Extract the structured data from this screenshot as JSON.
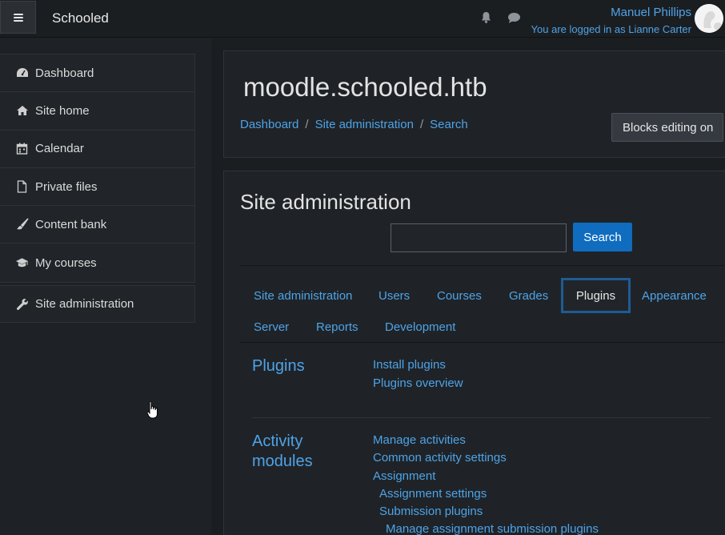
{
  "navbar": {
    "brand": "Schooled",
    "user_name": "Manuel Phillips",
    "logged_in_text": "You are logged in as Lianne Carter"
  },
  "sidebar": {
    "items": [
      {
        "label": "Dashboard",
        "icon": "dashboard-icon"
      },
      {
        "label": "Site home",
        "icon": "home-icon"
      },
      {
        "label": "Calendar",
        "icon": "calendar-icon"
      },
      {
        "label": "Private files",
        "icon": "file-icon"
      },
      {
        "label": "Content bank",
        "icon": "brush-icon"
      },
      {
        "label": "My courses",
        "icon": "graduation-cap-icon"
      }
    ],
    "admin_item": {
      "label": "Site administration",
      "icon": "wrench-icon"
    }
  },
  "header": {
    "title": "moodle.schooled.htb",
    "breadcrumb": [
      "Dashboard",
      "Site administration",
      "Search"
    ],
    "blocks_editing_label": "Blocks editing on"
  },
  "main": {
    "heading": "Site administration",
    "search": {
      "value": "",
      "button_label": "Search"
    },
    "tabs": [
      "Site administration",
      "Users",
      "Courses",
      "Grades",
      "Plugins",
      "Appearance",
      "Server",
      "Reports",
      "Development"
    ],
    "active_tab": "Plugins",
    "categories": [
      {
        "title": "Plugins",
        "links": [
          "Install plugins",
          "Plugins overview"
        ]
      },
      {
        "title_line1": "Activity",
        "title_line2": "modules",
        "links": [
          "Manage activities",
          "Common activity settings",
          "Assignment",
          "Assignment settings",
          "Submission plugins",
          "Manage assignment submission plugins"
        ]
      }
    ]
  },
  "colors": {
    "accent_link": "#4ea3e8",
    "primary_button": "#0f6cbf",
    "background": "#1b1e21"
  }
}
